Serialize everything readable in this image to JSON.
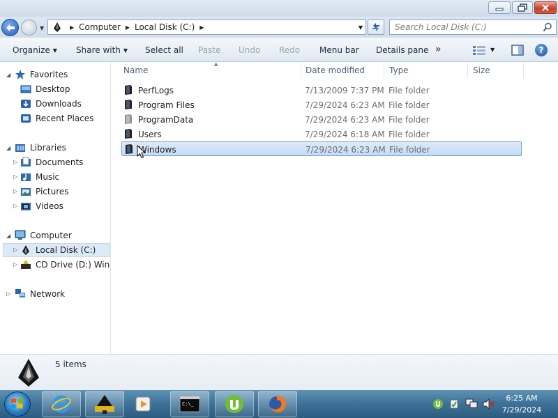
{
  "window": {
    "controls": {
      "minimize": "minimize-icon",
      "maximize": "maximize-icon",
      "close": "close-icon"
    }
  },
  "address": {
    "crumbs": [
      "Computer",
      "Local Disk (C:)"
    ],
    "search_placeholder": "Search Local Disk (C:)"
  },
  "toolbar": {
    "organize": "Organize",
    "share_with": "Share with",
    "select_all": "Select all",
    "paste": "Paste",
    "undo": "Undo",
    "redo": "Redo",
    "menu_bar": "Menu bar",
    "details_pane": "Details pane",
    "more": "»"
  },
  "nav": {
    "favorites": {
      "label": "Favorites",
      "items": [
        "Desktop",
        "Downloads",
        "Recent Places"
      ]
    },
    "libraries": {
      "label": "Libraries",
      "items": [
        "Documents",
        "Music",
        "Pictures",
        "Videos"
      ]
    },
    "computer": {
      "label": "Computer",
      "items": [
        "Local Disk (C:)",
        "CD Drive (D:) Windo"
      ]
    },
    "network": {
      "label": "Network"
    }
  },
  "columns": [
    "Name",
    "Date modified",
    "Type",
    "Size"
  ],
  "files": [
    {
      "name": "PerfLogs",
      "date": "7/13/2009 7:37 PM",
      "type": "File folder"
    },
    {
      "name": "Program Files",
      "date": "7/29/2024 6:23 AM",
      "type": "File folder"
    },
    {
      "name": "ProgramData",
      "date": "7/29/2024 6:23 AM",
      "type": "File folder"
    },
    {
      "name": "Users",
      "date": "7/29/2024 6:18 AM",
      "type": "File folder"
    },
    {
      "name": "Windows",
      "date": "7/29/2024 6:23 AM",
      "type": "File folder"
    }
  ],
  "selected_file": "Windows",
  "status": {
    "item_count": "5 items"
  },
  "taskbar": {
    "apps": [
      "internet-explorer-icon",
      "explorer-icon",
      "media-player-icon",
      "command-prompt-icon",
      "utorrent-icon",
      "firefox-icon"
    ],
    "time": "6:25 AM",
    "date": "7/29/2024"
  },
  "colors": {
    "selection": "#c5dcf5",
    "taskbar": "#3f7399",
    "title": "#dfe9f5"
  }
}
